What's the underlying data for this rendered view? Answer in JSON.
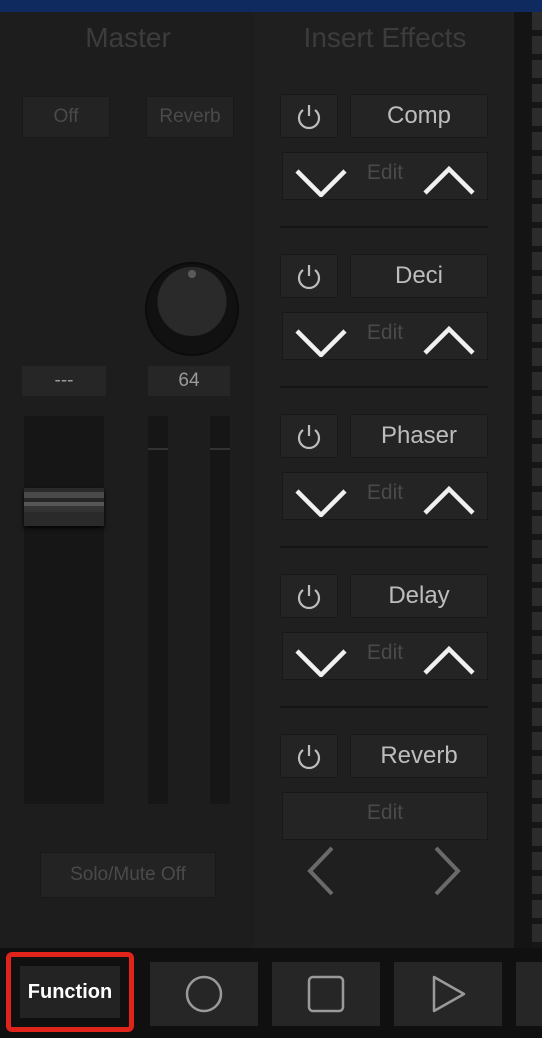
{
  "master": {
    "title": "Master",
    "send_off_label": "Off",
    "send_reverb_label": "Reverb",
    "fader_display": "---",
    "knob_display": "64",
    "solo_mute_label": "Solo/Mute Off"
  },
  "insert_effects": {
    "title": "Insert Effects",
    "slots": [
      {
        "name": "Comp",
        "edit_label": "Edit"
      },
      {
        "name": "Deci",
        "edit_label": "Edit"
      },
      {
        "name": "Phaser",
        "edit_label": "Edit"
      },
      {
        "name": "Delay",
        "edit_label": "Edit"
      },
      {
        "name": "Reverb",
        "edit_label": "Edit"
      }
    ]
  },
  "transport": {
    "function_label": "Function",
    "icons": [
      "record-icon",
      "stop-icon",
      "play-icon"
    ]
  },
  "colors": {
    "highlight": "#e0241b",
    "background": "#1c1c1c",
    "top_bar": "#0e2a5e"
  }
}
